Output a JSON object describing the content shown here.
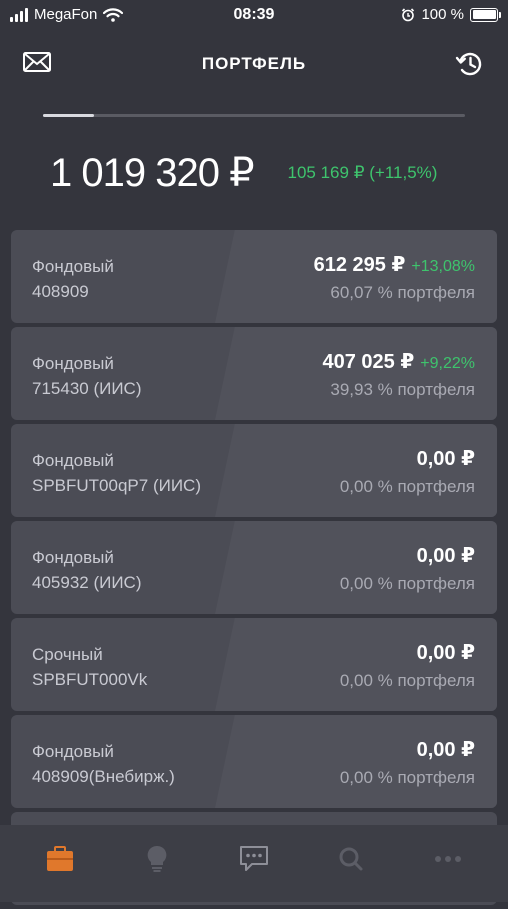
{
  "status_bar": {
    "carrier": "MegaFon",
    "time": "08:39",
    "battery": "100 %"
  },
  "header": {
    "title": "ПОРТФЕЛЬ",
    "left_icon": "mail-icon",
    "right_icon": "history-icon"
  },
  "summary": {
    "page_indicator_progress": 0.12,
    "total": "1 019 320 ₽",
    "change": "105 169 ₽ (+11,5%)"
  },
  "accounts": [
    {
      "type": "Фондовый",
      "id": "408909",
      "amount": "612 295 ₽",
      "change": "+13,08%",
      "share": "60,07 % портфеля"
    },
    {
      "type": "Фондовый",
      "id": "715430 (ИИС)",
      "amount": "407 025 ₽",
      "change": "+9,22%",
      "share": "39,93 % портфеля"
    },
    {
      "type": "Фондовый",
      "id": "SPBFUT00qP7 (ИИС)",
      "amount": "0,00 ₽",
      "change": "",
      "share": "0,00 % портфеля"
    },
    {
      "type": "Фондовый",
      "id": "405932 (ИИС)",
      "amount": "0,00 ₽",
      "change": "",
      "share": "0,00 % портфеля"
    },
    {
      "type": "Срочный",
      "id": "SPBFUT000Vk",
      "amount": "0,00 ₽",
      "change": "",
      "share": "0,00 % портфеля"
    },
    {
      "type": "Фондовый",
      "id": "408909(Внебирж.)",
      "amount": "0,00 ₽",
      "change": "",
      "share": "0,00 % портфеля"
    }
  ],
  "tabbar": {
    "tabs": [
      {
        "icon": "briefcase-icon",
        "active": true
      },
      {
        "icon": "lightbulb-icon",
        "active": false
      },
      {
        "icon": "chat-icon",
        "active": false
      },
      {
        "icon": "search-icon",
        "active": false
      },
      {
        "icon": "more-icon",
        "active": false
      }
    ]
  },
  "colors": {
    "background": "#34353d",
    "card": "#4b4c55",
    "positive": "#3ec46d",
    "active_tab": "#e0782c"
  }
}
